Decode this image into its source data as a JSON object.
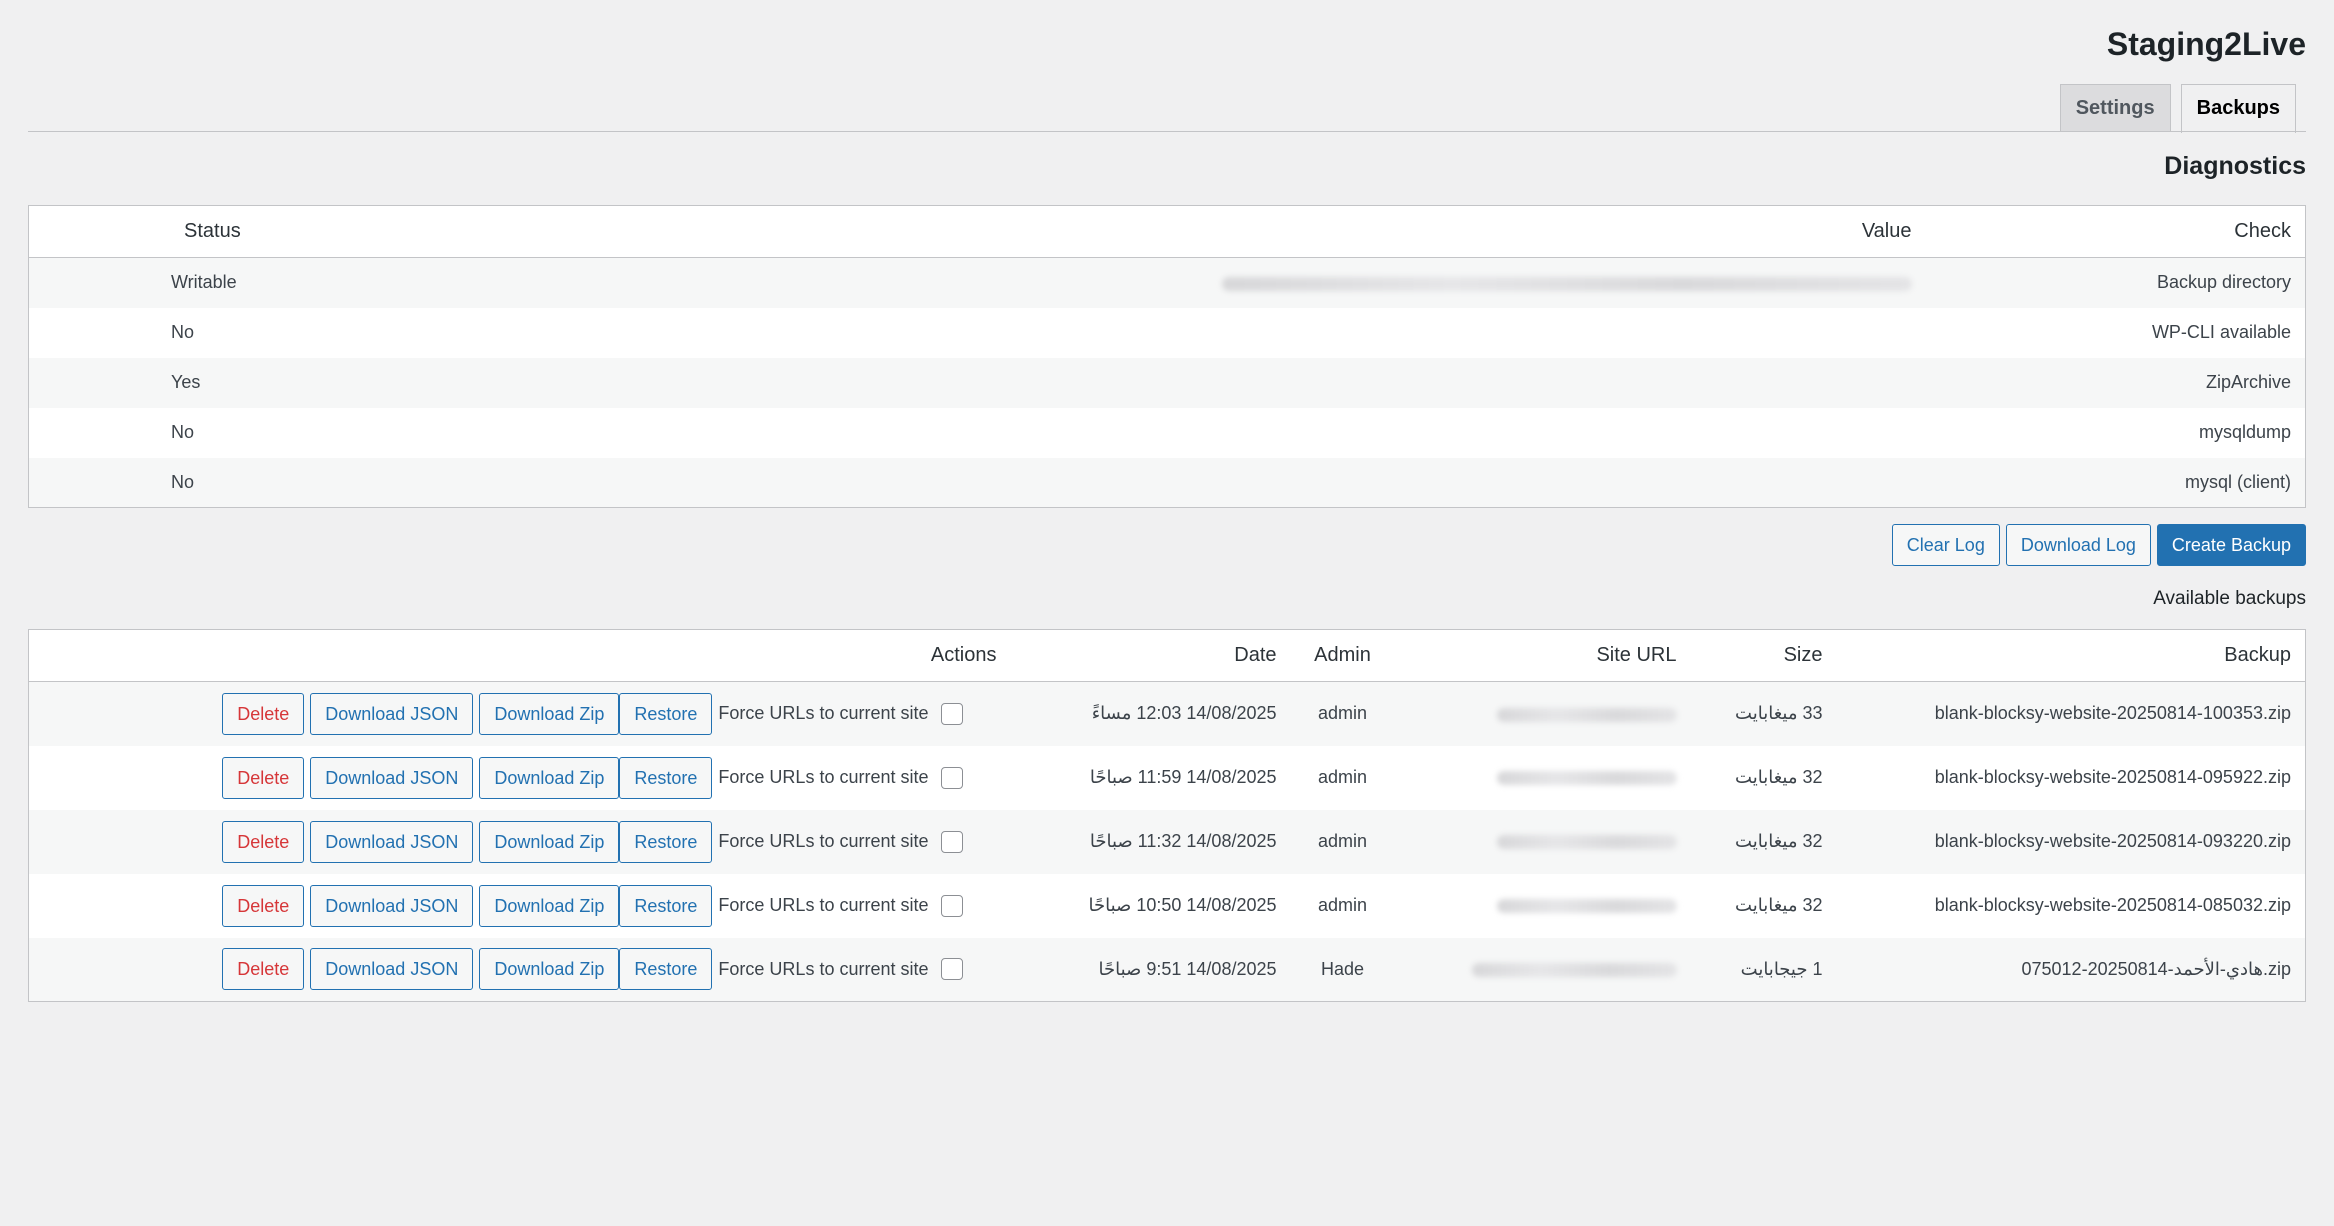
{
  "header": {
    "title": "Staging2Live",
    "tabs": [
      {
        "label": "Settings",
        "active": false
      },
      {
        "label": "Backups",
        "active": true
      }
    ]
  },
  "diagnostics": {
    "title": "Diagnostics",
    "columns": {
      "status": "Status",
      "value": "Value",
      "check": "Check"
    },
    "rows": [
      {
        "status": "Writable",
        "value_blurred": true,
        "check": "Backup directory"
      },
      {
        "status": "No",
        "value_blurred": false,
        "check": "WP-CLI available"
      },
      {
        "status": "Yes",
        "value_blurred": false,
        "check": "ZipArchive"
      },
      {
        "status": "No",
        "value_blurred": false,
        "check": "mysqldump"
      },
      {
        "status": "No",
        "value_blurred": false,
        "check": "mysql (client)"
      }
    ]
  },
  "toolbar": {
    "clear_log": "Clear Log",
    "download_log": "Download Log",
    "create_backup": "Create Backup"
  },
  "backups": {
    "title": "Available backups",
    "columns": {
      "actions": "Actions",
      "date": "Date",
      "admin": "Admin",
      "site_url": "Site URL",
      "size": "Size",
      "backup": "Backup"
    },
    "action_labels": {
      "delete": "Delete",
      "download_json": "Download JSON",
      "download_zip": "Download Zip",
      "restore": "Restore",
      "force_urls": "Force URLs to current site"
    },
    "rows": [
      {
        "backup": "blank-blocksy-website-20250814-100353.zip",
        "size": "33 ميغابايت",
        "admin": "admin",
        "date": "14/08/2025 12:03 مساءً"
      },
      {
        "backup": "blank-blocksy-website-20250814-095922.zip",
        "size": "32 ميغابايت",
        "admin": "admin",
        "date": "14/08/2025 11:59 صباحًا"
      },
      {
        "backup": "blank-blocksy-website-20250814-093220.zip",
        "size": "32 ميغابايت",
        "admin": "admin",
        "date": "14/08/2025 11:32 صباحًا"
      },
      {
        "backup": "blank-blocksy-website-20250814-085032.zip",
        "size": "32 ميغابايت",
        "admin": "admin",
        "date": "14/08/2025 10:50 صباحًا"
      },
      {
        "backup": "هادي-الأحمد-20250814-075012.zip",
        "size": "1 جيجابايت",
        "admin": "Hade",
        "date": "14/08/2025 9:51 صباحًا"
      }
    ]
  },
  "colors": {
    "accent": "#2271b1",
    "danger": "#d63638",
    "background": "#f0f0f1"
  }
}
